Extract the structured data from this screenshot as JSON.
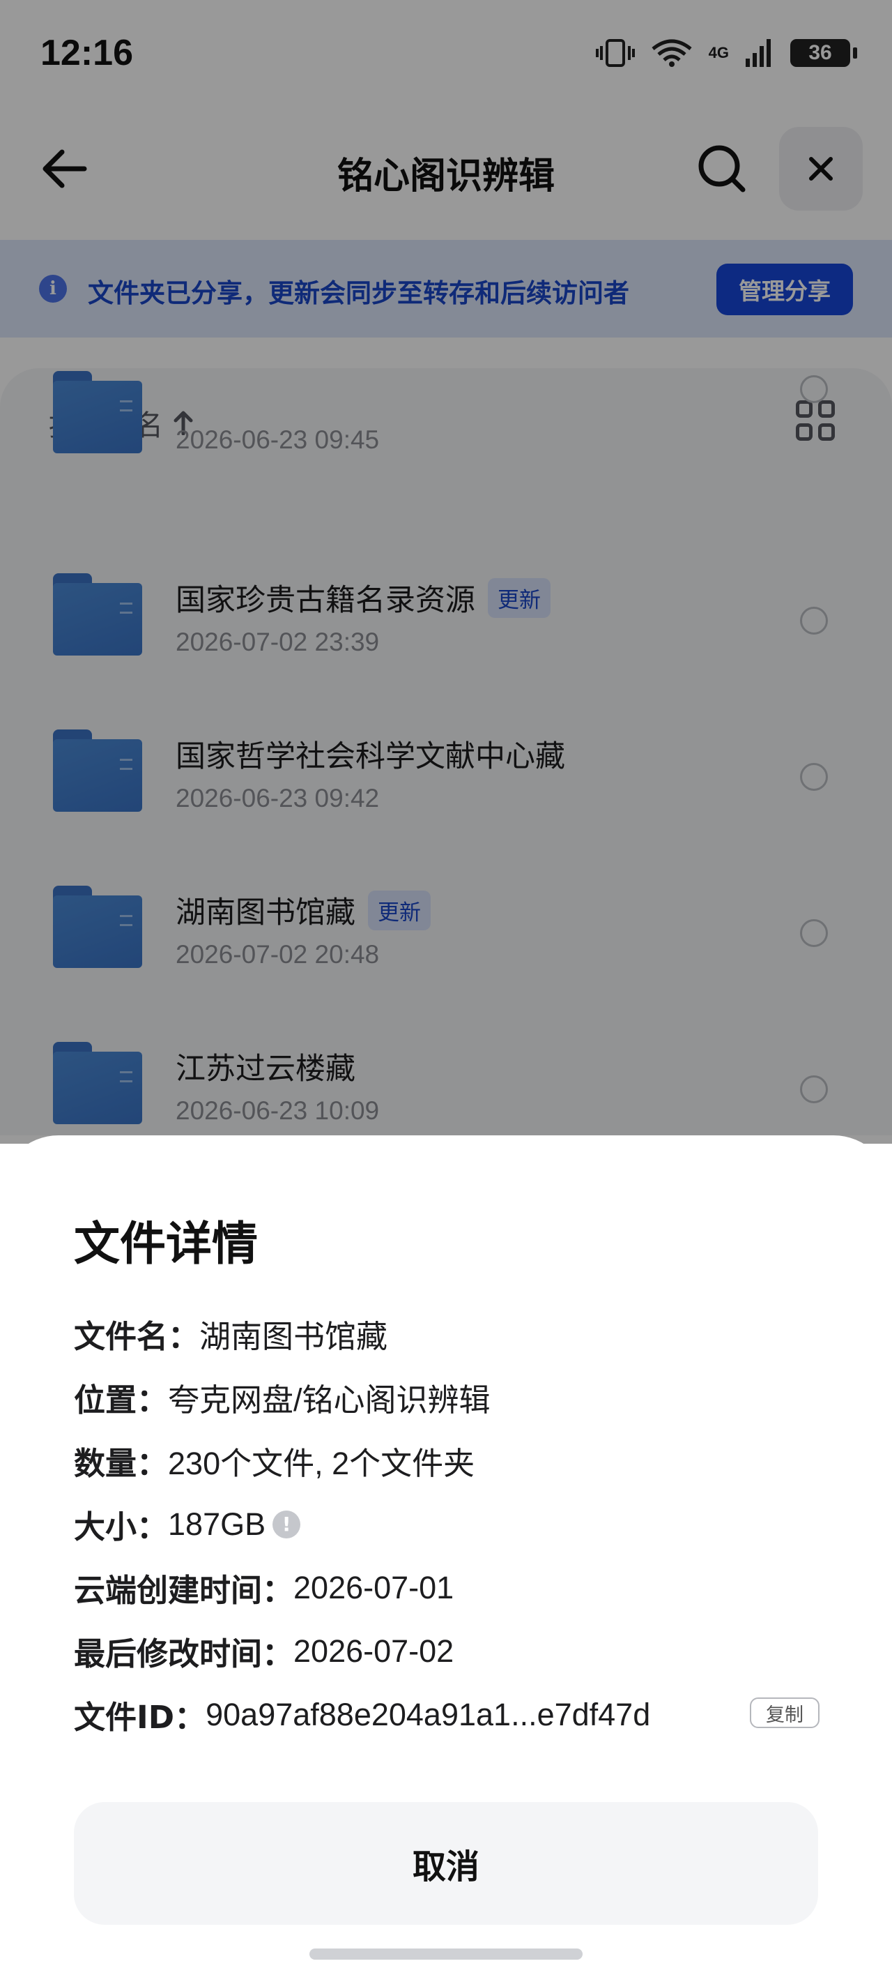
{
  "status": {
    "time": "12:16",
    "network": "4G",
    "battery": "36"
  },
  "nav": {
    "title": "铭心阁识辨辑"
  },
  "banner": {
    "text": "文件夹已分享，更新会同步至转存和后续访问者",
    "button": "管理分享"
  },
  "list": {
    "sort_label": "按文件名",
    "items": [
      {
        "name": "",
        "date": "2026-06-23 09:45",
        "badge": ""
      },
      {
        "name": "国家珍贵古籍名录资源",
        "date": "2026-07-02 23:39",
        "badge": "更新"
      },
      {
        "name": "国家哲学社会科学文献中心藏",
        "date": "2026-06-23 09:42",
        "badge": ""
      },
      {
        "name": "湖南图书馆藏",
        "date": "2026-07-02 20:48",
        "badge": "更新"
      },
      {
        "name": "江苏过云楼藏",
        "date": "2026-06-23 10:09",
        "badge": ""
      }
    ]
  },
  "sheet": {
    "title": "文件详情",
    "details": [
      {
        "key": "文件名：",
        "value": "湖南图书馆藏"
      },
      {
        "key": "位置：",
        "value": "夸克网盘/铭心阁识辨辑"
      },
      {
        "key": "数量：",
        "value": "230个文件, 2个文件夹"
      },
      {
        "key": "大小：",
        "value": "187GB"
      },
      {
        "key": "云端创建时间：",
        "value": "2026-07-01"
      },
      {
        "key": "最后修改时间：",
        "value": "2026-07-02"
      },
      {
        "key": "文件ID：",
        "value": "90a97af88e204a91a1...e7df47d"
      }
    ],
    "copy_label": "复制",
    "cancel_label": "取消"
  },
  "colors": {
    "accent": "#1747d9",
    "banner_bg": "#dde6fb",
    "folder": "#3a74c6"
  }
}
